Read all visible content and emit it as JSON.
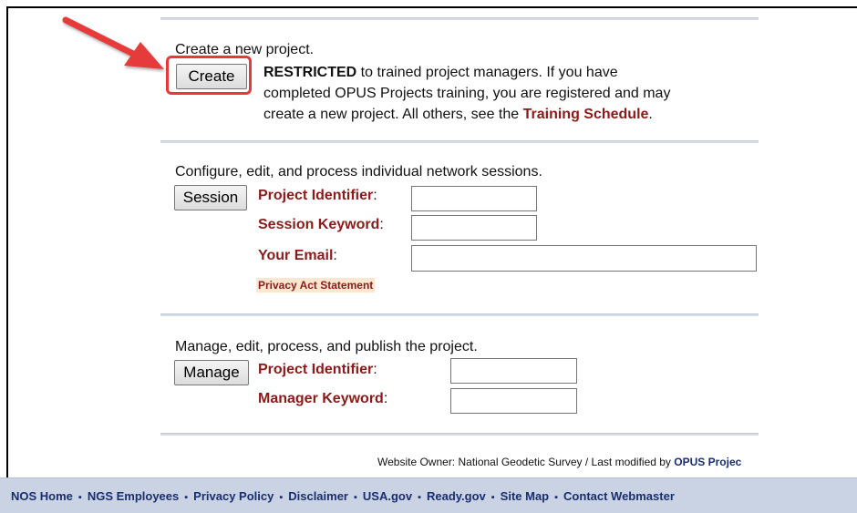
{
  "create_section": {
    "title": "Create a new project.",
    "button_label": "Create",
    "restricted_label": "RESTRICTED",
    "line1_rest": " to trained project managers. If you have",
    "line2": "completed OPUS Projects training, you are registered and may",
    "line3_pre": "create a new project. All others, see the ",
    "training_link": "Training Schedule",
    "line3_post": "."
  },
  "session_section": {
    "title": "Configure, edit, and process individual network sessions.",
    "button_label": "Session",
    "project_identifier_label": "Project Identifier",
    "session_keyword_label": "Session Keyword",
    "email_label": "Your Email",
    "colon": ":",
    "privacy_link": "Privacy Act Statement",
    "project_identifier_value": "",
    "session_keyword_value": "",
    "email_value": ""
  },
  "manage_section": {
    "title": "Manage, edit, process, and publish the project.",
    "button_label": "Manage",
    "project_identifier_label": "Project Identifier",
    "manager_keyword_label": "Manager Keyword",
    "colon": ":",
    "project_identifier_value": "",
    "manager_keyword_value": ""
  },
  "footer": {
    "owner_text": "Website Owner: National Geodetic Survey  /  Last modified by ",
    "modified_by": "OPUS Projec",
    "nav": [
      "NOS Home",
      "NGS Employees",
      "Privacy Policy",
      "Disclaimer",
      "USA.gov",
      "Ready.gov",
      "Site Map",
      "Contact Webmaster"
    ],
    "separator": "▪"
  },
  "annotation": {
    "arrow_color": "#e53a3a",
    "highlight_color": "#e53a3a"
  }
}
